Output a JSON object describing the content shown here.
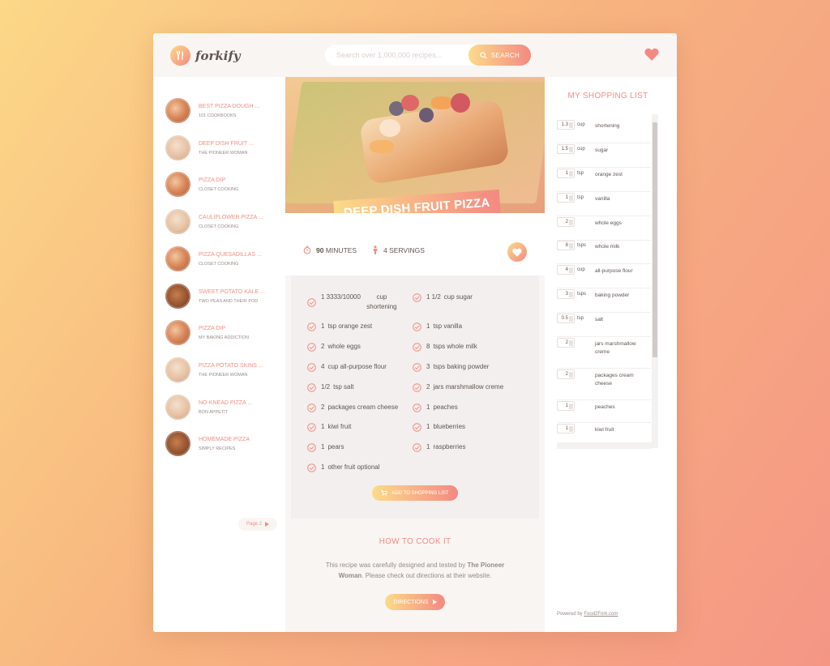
{
  "header": {
    "logo_text": "forkify",
    "search_placeholder": "Search over 1,000,000 recipes...",
    "search_button": "SEARCH"
  },
  "results": [
    {
      "title": "BEST PIZZA DOUGH ...",
      "author": "101 COOKBOOKS"
    },
    {
      "title": "DEEP DISH FRUIT ...",
      "author": "THE PIONEER WOMAN"
    },
    {
      "title": "PIZZA DIP",
      "author": "CLOSET COOKING"
    },
    {
      "title": "CAULIFLOWER PIZZA ...",
      "author": "CLOSET COOKING"
    },
    {
      "title": "PIZZA QUESADILLAS ...",
      "author": "CLOSET COOKING"
    },
    {
      "title": "SWEET POTATO KALE ...",
      "author": "TWO PEAS AND THEIR POD"
    },
    {
      "title": "PIZZA DIP",
      "author": "MY BAKING ADDICTION"
    },
    {
      "title": "PIZZA POTATO SKINS ...",
      "author": "THE PIONEER WOMAN"
    },
    {
      "title": "NO-KNEAD PIZZA ...",
      "author": "BON APPETIT"
    },
    {
      "title": "HOMEMADE PIZZA",
      "author": "SIMPLY RECIPES"
    }
  ],
  "pagination": {
    "next_label": "Page 2"
  },
  "recipe": {
    "title": "DEEP DISH FRUIT PIZZA",
    "time": "90",
    "time_unit": "MINUTES",
    "servings": "4",
    "servings_unit": "SERVINGS"
  },
  "ingredients": [
    {
      "amount": "1 3333/10000",
      "text": "cup shortening"
    },
    {
      "amount": "1 1/2",
      "text": "cup sugar"
    },
    {
      "amount": "1",
      "text": "tsp orange zest"
    },
    {
      "amount": "1",
      "text": "tsp vanilla"
    },
    {
      "amount": "2",
      "text": "whole eggs"
    },
    {
      "amount": "8",
      "text": "tsps whole milk"
    },
    {
      "amount": "4",
      "text": "cup all-purpose flour"
    },
    {
      "amount": "3",
      "text": "tsps baking powder"
    },
    {
      "amount": "1/2",
      "text": "tsp salt"
    },
    {
      "amount": "2",
      "text": "jars marshmallow creme"
    },
    {
      "amount": "2",
      "text": "packages cream cheese"
    },
    {
      "amount": "1",
      "text": "peaches"
    },
    {
      "amount": "1",
      "text": "kiwi fruit"
    },
    {
      "amount": "1",
      "text": "blueberries"
    },
    {
      "amount": "1",
      "text": "pears"
    },
    {
      "amount": "1",
      "text": "raspberries"
    },
    {
      "amount": "1",
      "text": "other fruit optional"
    }
  ],
  "add_to_list_button": "ADD TO SHOPPING LIST",
  "howto": {
    "title": "HOW TO COOK IT",
    "text_before": "This recipe was carefully designed and tested by ",
    "publisher": "The Pioneer Woman",
    "text_after": ". Please check out directions at their website.",
    "button": "DIRECTIONS"
  },
  "shopping": {
    "title": "MY SHOPPING LIST",
    "items": [
      {
        "qty": "1.3",
        "unit": "cup",
        "desc": "shortening"
      },
      {
        "qty": "1.5",
        "unit": "cup",
        "desc": "sugar"
      },
      {
        "qty": "1",
        "unit": "tsp",
        "desc": "orange zest"
      },
      {
        "qty": "1",
        "unit": "tsp",
        "desc": "vanilla"
      },
      {
        "qty": "2",
        "unit": "",
        "desc": "whole eggs"
      },
      {
        "qty": "8",
        "unit": "tsps",
        "desc": "whole milk"
      },
      {
        "qty": "4",
        "unit": "cup",
        "desc": "all-purpose flour"
      },
      {
        "qty": "3",
        "unit": "tsps",
        "desc": "baking powder"
      },
      {
        "qty": "0.5",
        "unit": "tsp",
        "desc": "salt"
      },
      {
        "qty": "2",
        "unit": "",
        "desc": "jars marshmallow creme"
      },
      {
        "qty": "2",
        "unit": "",
        "desc": "packages cream cheese"
      },
      {
        "qty": "1",
        "unit": "",
        "desc": "peaches"
      },
      {
        "qty": "1",
        "unit": "",
        "desc": "kiwi fruit"
      }
    ],
    "powered_prefix": "Powered by ",
    "powered_link": "Food2Fork.com"
  },
  "colors": {
    "accent_start": "#fbdb89",
    "accent_end": "#f48982",
    "text": "#615551"
  }
}
